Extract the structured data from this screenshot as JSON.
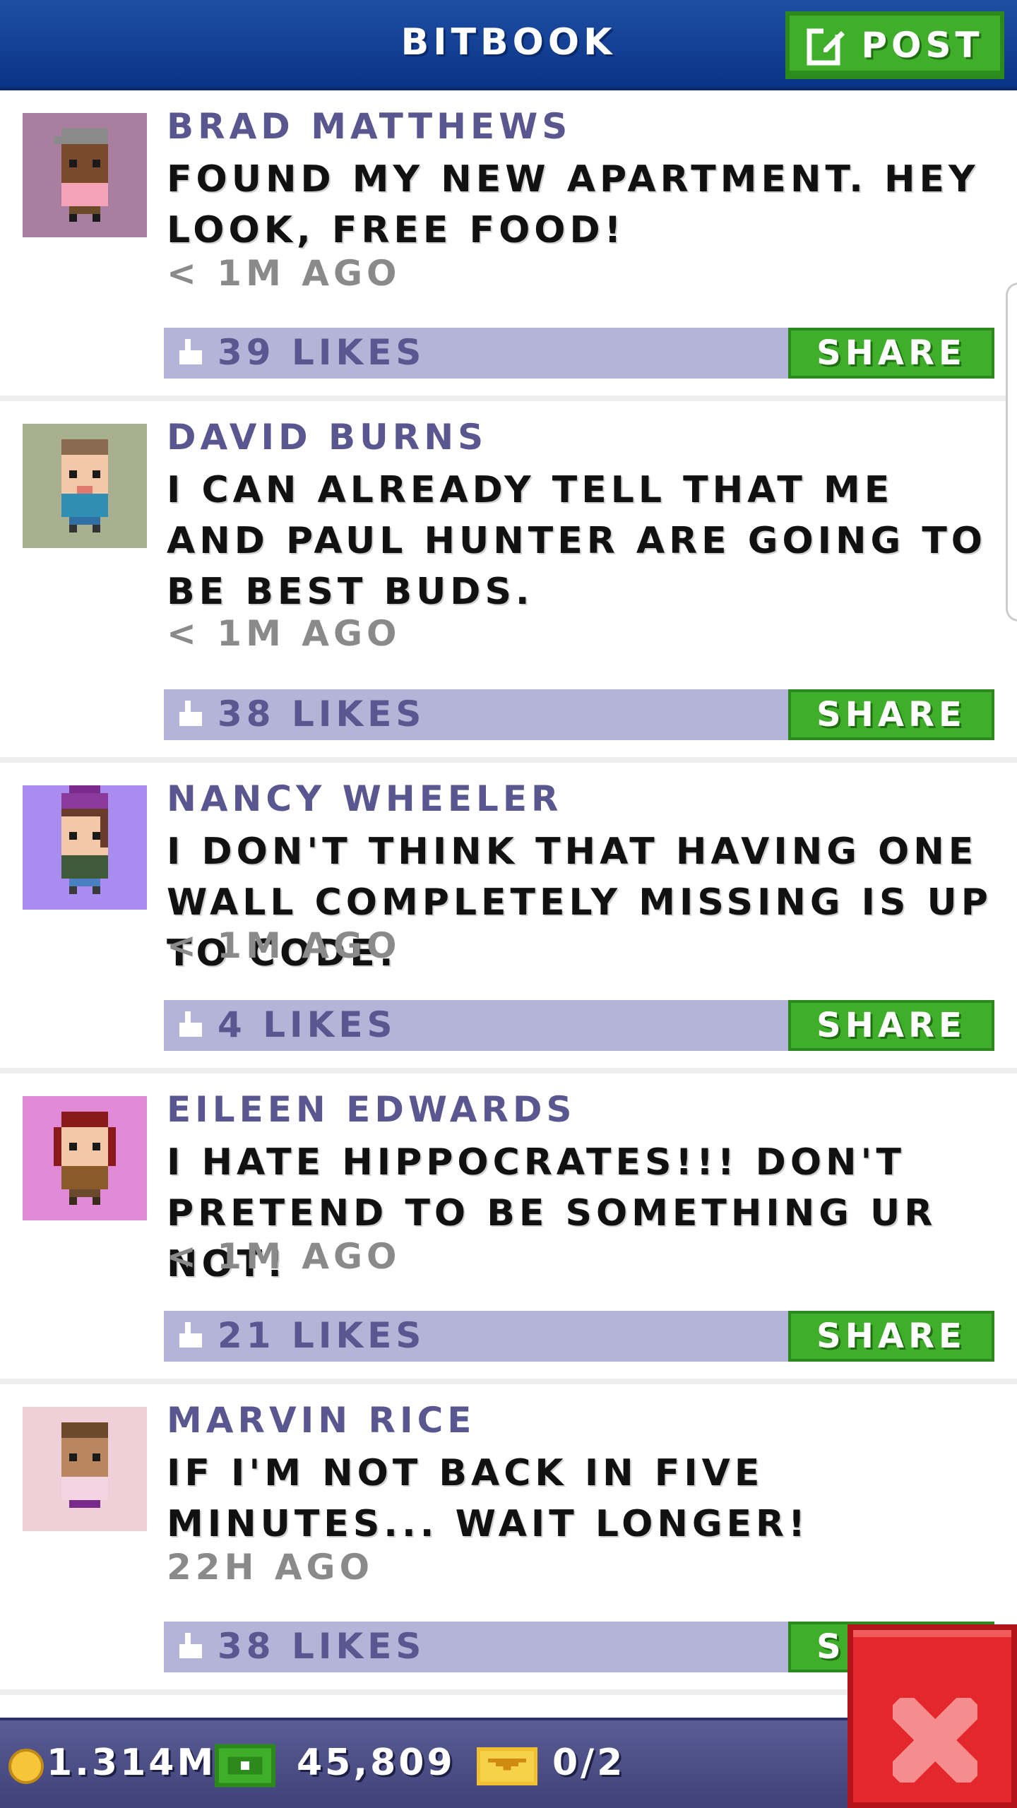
{
  "header": {
    "title": "BITBOOK",
    "post_label": "POST"
  },
  "posts": [
    {
      "author": "BRAD MATTHEWS",
      "message": "FOUND MY NEW APARTMENT. HEY LOOK, FREE FOOD!",
      "time": "< 1M AGO",
      "likes": "39 LIKES",
      "share": "SHARE"
    },
    {
      "author": "DAVID BURNS",
      "message": "I CAN ALREADY TELL THAT ME AND PAUL HUNTER ARE GOING TO BE BEST BUDS.",
      "time": "< 1M AGO",
      "likes": "38 LIKES",
      "share": "SHARE"
    },
    {
      "author": "NANCY WHEELER",
      "message": "I DON'T THINK THAT HAVING ONE WALL COMPLETELY MISSING IS UP TO CODE.",
      "time": "< 1M AGO",
      "likes": "4 LIKES",
      "share": "SHARE"
    },
    {
      "author": "EILEEN EDWARDS",
      "message": "I HATE HIPPOCRATES!!! DON'T PRETEND TO BE SOMETHING UR NOT!",
      "time": "< 1M AGO",
      "likes": "21 LIKES",
      "share": "SHARE"
    },
    {
      "author": "MARVIN RICE",
      "message": "IF I'M NOT BACK IN FIVE MINUTES... WAIT LONGER!",
      "time": "22H AGO",
      "likes": "38 LIKES",
      "share": "SHARE"
    }
  ],
  "footer": {
    "coins": "1.314M",
    "bux": "45,809",
    "tickets": "0/2"
  },
  "colors": {
    "header_blue": "#0b3386",
    "accent_green": "#3fae2a",
    "likes_bar": "#b3b4d8",
    "author_purple": "#5a568f",
    "close_red": "#e3272b"
  }
}
